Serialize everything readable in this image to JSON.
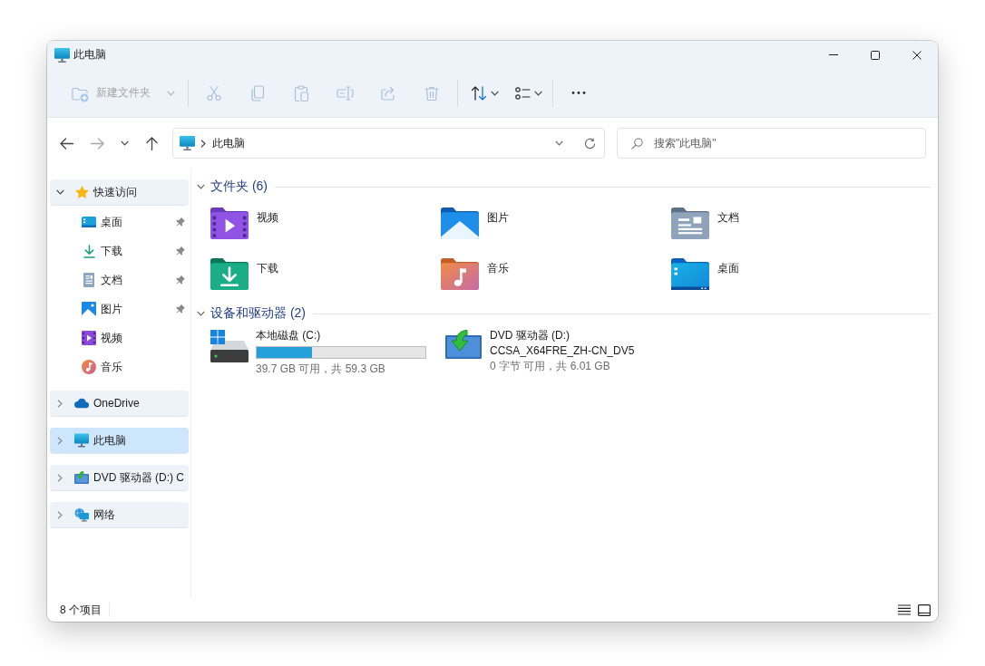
{
  "window": {
    "title": "此电脑"
  },
  "toolbar": [
    {
      "buttons": [
        {
          "kind": "new-folder",
          "label": "新建文件夹",
          "disabled": true,
          "dropdown": true
        }
      ]
    },
    {
      "buttons": [
        {
          "kind": "cut",
          "disabled": true
        },
        {
          "kind": "copy",
          "disabled": true
        },
        {
          "kind": "paste",
          "disabled": true
        },
        {
          "kind": "rename",
          "disabled": true
        },
        {
          "kind": "share",
          "disabled": true
        },
        {
          "kind": "delete",
          "disabled": true
        }
      ]
    },
    {
      "buttons": [
        {
          "kind": "sort",
          "disabled": false,
          "dropdown": true
        },
        {
          "kind": "view",
          "disabled": false,
          "dropdown": true
        }
      ]
    },
    {
      "buttons": [
        {
          "kind": "more",
          "disabled": false
        }
      ]
    }
  ],
  "navigation": [
    {
      "kind": "back",
      "disabled": false
    },
    {
      "kind": "forward",
      "disabled": true
    },
    {
      "kind": "recent",
      "disabled": false
    },
    {
      "kind": "up",
      "disabled": false
    }
  ],
  "address": {
    "segments": [
      "此电脑"
    ]
  },
  "search": {
    "placeholder": "搜索\"此电脑\""
  },
  "sidebar": [
    {
      "kind": "quick-access",
      "label": "快速访问",
      "expanded": true,
      "selected": false,
      "children": [
        {
          "kind": "desktop",
          "label": "桌面",
          "pinned": true,
          "selected": false
        },
        {
          "kind": "downloads",
          "label": "下载",
          "pinned": true,
          "selected": false
        },
        {
          "kind": "documents",
          "label": "文档",
          "pinned": true,
          "selected": false
        },
        {
          "kind": "pictures",
          "label": "图片",
          "pinned": true,
          "selected": false
        },
        {
          "kind": "videos",
          "label": "视频",
          "pinned": false,
          "selected": false
        },
        {
          "kind": "music",
          "label": "音乐",
          "pinned": false,
          "selected": false
        }
      ]
    },
    {
      "kind": "onedrive",
      "label": "OneDrive",
      "expanded": false,
      "selected": false
    },
    {
      "kind": "pc",
      "label": "此电脑",
      "expanded": false,
      "selected": true
    },
    {
      "kind": "dvd",
      "label": "DVD 驱动器 (D:) C",
      "expanded": false,
      "selected": false
    },
    {
      "kind": "network",
      "label": "网络",
      "expanded": false,
      "selected": false
    }
  ],
  "content": [
    {
      "kind": "folders",
      "title": "文件夹 (6)",
      "expanded": true,
      "items": [
        {
          "kind": "videos",
          "name": "视频"
        },
        {
          "kind": "pictures",
          "name": "图片"
        },
        {
          "kind": "documents",
          "name": "文档"
        },
        {
          "kind": "downloads",
          "name": "下载"
        },
        {
          "kind": "music",
          "name": "音乐"
        },
        {
          "kind": "desktop",
          "name": "桌面"
        }
      ]
    },
    {
      "kind": "drives",
      "title": "设备和驱动器 (2)",
      "expanded": true,
      "items": [
        {
          "kind": "disk",
          "name": "本地磁盘 (C:)",
          "level": 0.33,
          "detail": "39.7 GB 可用，共 59.3 GB"
        },
        {
          "kind": "dvd",
          "name": "DVD 驱动器 (D:)",
          "volume": "CCSA_X64FRE_ZH-CN_DV5",
          "detail": "0 字节 可用，共 6.01 GB"
        }
      ]
    }
  ],
  "status_bar": {
    "text": "8 个项目",
    "views": [
      {
        "kind": "details"
      },
      {
        "kind": "tiles"
      }
    ]
  }
}
